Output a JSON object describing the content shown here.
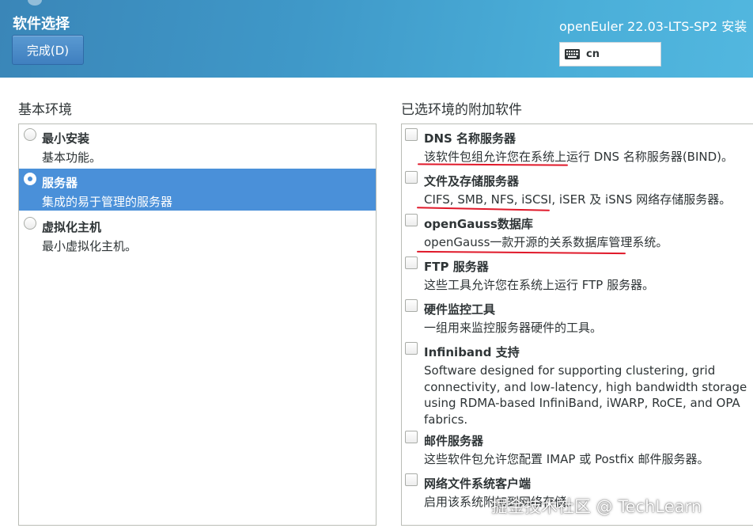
{
  "header": {
    "title": "软件选择",
    "done_button": "完成(D)",
    "product": "openEuler 22.03-LTS-SP2 安装",
    "keyboard_layout": "cn"
  },
  "environments": {
    "title": "基本环境",
    "items": [
      {
        "name": "最小安装",
        "desc": "基本功能。",
        "selected": false
      },
      {
        "name": "服务器",
        "desc": "集成的易于管理的服务器",
        "selected": true
      },
      {
        "name": "虚拟化主机",
        "desc": "最小虚拟化主机。",
        "selected": false
      }
    ]
  },
  "addons": {
    "title": "已选环境的附加软件",
    "items": [
      {
        "name": "DNS 名称服务器",
        "desc": "该软件包组允许您在系统上运行 DNS 名称服务器(BIND)。",
        "checked": false
      },
      {
        "name": "文件及存储服务器",
        "desc": "CIFS, SMB, NFS, iSCSI, iSER 及 iSNS 网络存储服务器。",
        "checked": false
      },
      {
        "name": "openGauss数据库",
        "desc": "openGauss一款开源的关系数据库管理系统。",
        "checked": false
      },
      {
        "name": "FTP 服务器",
        "desc": "这些工具允许您在系统上运行 FTP 服务器。",
        "checked": false
      },
      {
        "name": "硬件监控工具",
        "desc": "一组用来监控服务器硬件的工具。",
        "checked": false
      },
      {
        "name": "Infiniband 支持",
        "desc_lines": [
          "Software designed for supporting clustering, grid",
          "connectivity, and low-latency, high bandwidth storage",
          "using RDMA-based InfiniBand, iWARP, RoCE, and OPA",
          "fabrics."
        ],
        "checked": false
      },
      {
        "name": "邮件服务器",
        "desc": "这些软件包允许您配置 IMAP 或 Postfix 邮件服务器。",
        "checked": false
      },
      {
        "name": "网络文件系统客户端",
        "desc": "启用该系统附加到网络存储。",
        "checked": false
      }
    ]
  },
  "colors": {
    "header_gradient_start": "#3a86b8",
    "header_gradient_end": "#52b7df",
    "selection": "#4a90d9",
    "annotation_red": "#e0192a"
  },
  "icons": {
    "keyboard": "keyboard-icon"
  },
  "watermark": "掘金技术社区 @ TechLearn"
}
